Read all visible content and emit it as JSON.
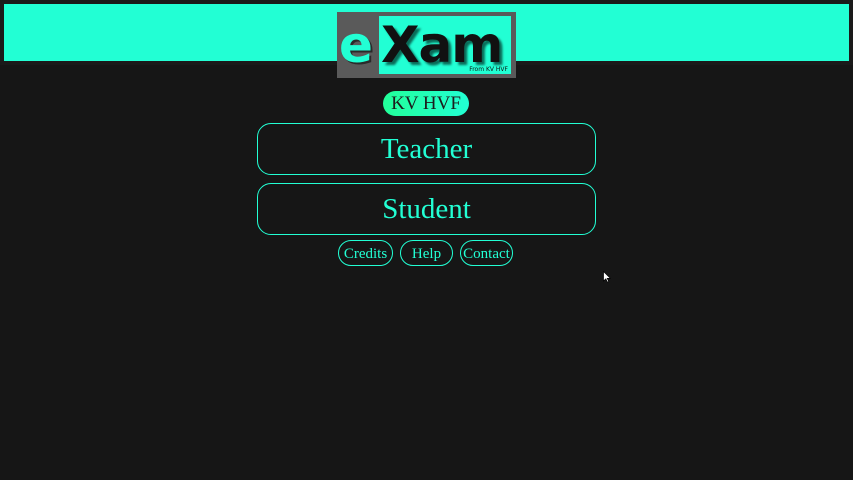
{
  "header": {
    "accent_color": "#22ffd4",
    "logo": {
      "letter_e": "e",
      "letters_xam": "Xam",
      "tagline": "From KV HVF"
    }
  },
  "school_badge": {
    "label": "KV HVF"
  },
  "main": {
    "teacher_label": "Teacher",
    "student_label": "Student"
  },
  "footer_links": {
    "credits_label": "Credits",
    "help_label": "Help",
    "contact_label": "Contact"
  },
  "icons": {
    "cursor": "mouse-pointer-icon"
  }
}
